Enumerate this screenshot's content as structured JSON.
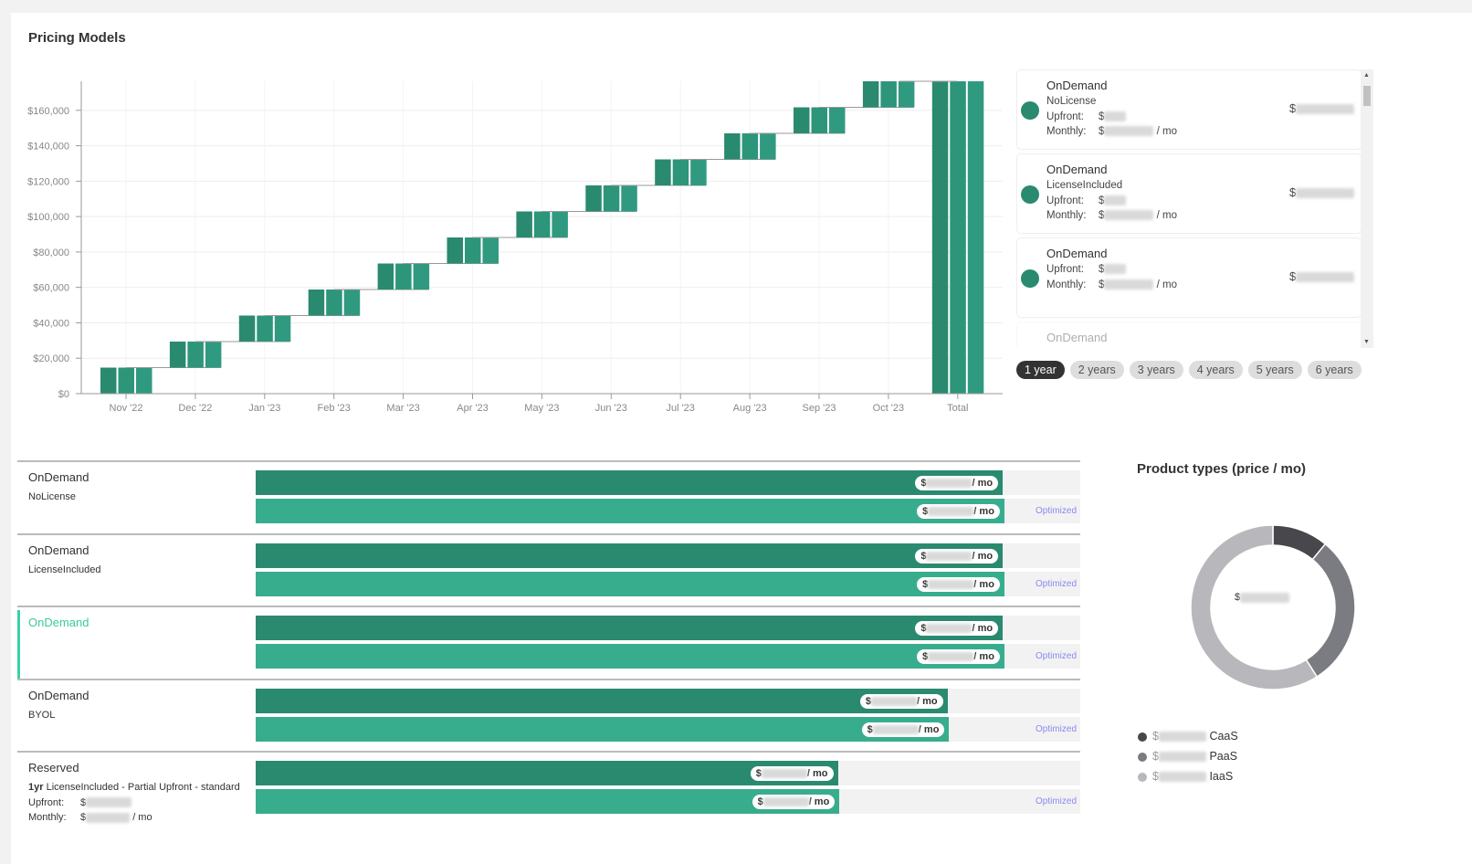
{
  "title": "Pricing Models",
  "chart_data": {
    "type": "bar",
    "subtype": "waterfall",
    "categories": [
      "Nov '22",
      "Dec '22",
      "Jan '23",
      "Feb '23",
      "Mar '23",
      "Apr '23",
      "May '23",
      "Jun '23",
      "Jul '23",
      "Aug '23",
      "Sep '23",
      "Oct '23",
      "Total"
    ],
    "ranges": [
      [
        0,
        14700
      ],
      [
        14700,
        29400
      ],
      [
        29400,
        44100
      ],
      [
        44100,
        58800
      ],
      [
        58800,
        73500
      ],
      [
        73500,
        88200
      ],
      [
        88200,
        102900
      ],
      [
        102900,
        117600
      ],
      [
        117600,
        132300
      ],
      [
        132300,
        147000
      ],
      [
        147000,
        161700
      ],
      [
        161700,
        176400
      ],
      [
        0,
        176400
      ]
    ],
    "sub_bars_per_category": 3,
    "ylim": [
      0,
      176400
    ],
    "yticks": [
      "$0",
      "$20,000",
      "$40,000",
      "$60,000",
      "$80,000",
      "$100,000",
      "$120,000",
      "$140,000",
      "$160,000"
    ],
    "ytick_values": [
      0,
      20000,
      40000,
      60000,
      80000,
      100000,
      120000,
      140000,
      160000
    ],
    "colors": [
      "#2a8a70",
      "#2d957a",
      "#309a80"
    ],
    "grid": true
  },
  "models": [
    {
      "name": "OnDemand",
      "sub": "NoLicense",
      "upfront_label": "Upfront:",
      "monthly_label": "Monthly:",
      "cur": "$",
      "per": "/ mo"
    },
    {
      "name": "OnDemand",
      "sub": "LicenseIncluded",
      "upfront_label": "Upfront:",
      "monthly_label": "Monthly:",
      "cur": "$",
      "per": "/ mo"
    },
    {
      "name": "OnDemand",
      "sub": "",
      "upfront_label": "Upfront:",
      "monthly_label": "Monthly:",
      "cur": "$",
      "per": "/ mo"
    },
    {
      "name": "OnDemand",
      "sub": "BYOL",
      "cur": "$"
    }
  ],
  "periods": [
    "1 year",
    "2 years",
    "3 years",
    "4 years",
    "5 years",
    "6 years"
  ],
  "selected_period": "1 year",
  "rows": [
    {
      "name": "OnDemand",
      "sub": "NoLicense",
      "current_pct": 90.6,
      "optimized_pct": 90.8
    },
    {
      "name": "OnDemand",
      "sub": "LicenseIncluded",
      "current_pct": 90.6,
      "optimized_pct": 90.8
    },
    {
      "name": "OnDemand",
      "sub": "",
      "current_pct": 90.6,
      "optimized_pct": 90.8,
      "selected": true
    },
    {
      "name": "OnDemand",
      "sub": "BYOL",
      "current_pct": 83.9,
      "optimized_pct": 84.1
    },
    {
      "name": "Reserved",
      "sub_bold": "1yr",
      "sub": " LicenseIncluded - Partial Upfront - standard",
      "upfront_label": "Upfront:",
      "monthly_label": "Monthly:",
      "current_pct": 70.6,
      "optimized_pct": 70.8
    }
  ],
  "bar_unit": "/ mo",
  "currency": "$",
  "optimized_label": "Optimized",
  "bar_colors": {
    "current": "#2a8a70",
    "optimized": "#38ad8e",
    "track": "#f2f2f2"
  },
  "product_types": {
    "title": "Product types (price / mo)",
    "center_cur": "$",
    "slices": [
      {
        "name": "CaaS",
        "share": 0.11,
        "color": "#47474c"
      },
      {
        "name": "PaaS",
        "share": 0.3,
        "color": "#7b7b82"
      },
      {
        "name": "IaaS",
        "share": 0.59,
        "color": "#b7b7bc"
      }
    ]
  }
}
